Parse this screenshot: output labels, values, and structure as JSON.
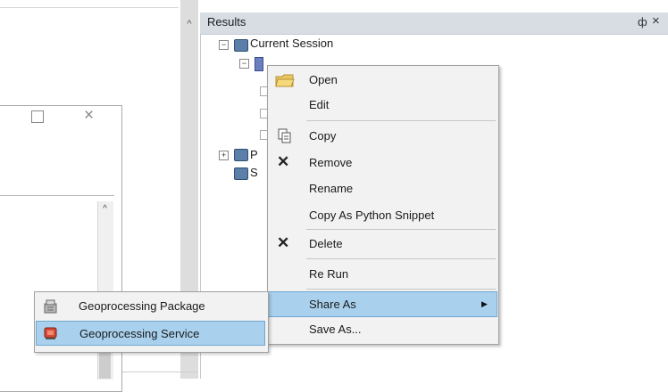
{
  "results_pane": {
    "title": "Results",
    "pin_glyph": "ф",
    "close_glyph": "×",
    "tree": {
      "current_session": "Current Session",
      "child_row_text": "",
      "p_row_text": "P",
      "s_row_text": "S"
    }
  },
  "context_menu": {
    "items": [
      {
        "label": "Open",
        "icon": "open-folder-icon"
      },
      {
        "label": "Edit",
        "icon": ""
      },
      {
        "label": "Copy",
        "icon": "copy-icon"
      },
      {
        "label": "Remove",
        "icon": "remove-x-icon"
      },
      {
        "label": "Rename",
        "icon": ""
      },
      {
        "label": "Copy As Python Snippet",
        "icon": ""
      },
      {
        "label": "Delete",
        "icon": "delete-x-icon"
      },
      {
        "label": "Re Run",
        "icon": ""
      },
      {
        "label": "Share As",
        "icon": "",
        "has_submenu": true
      },
      {
        "label": "Save As...",
        "icon": ""
      }
    ],
    "highlighted": "Share As"
  },
  "submenu": {
    "items": [
      {
        "label": "Geoprocessing Package",
        "icon": "geoprocessing-package-icon"
      },
      {
        "label": "Geoprocessing Service",
        "icon": "geoprocessing-service-icon"
      }
    ],
    "highlighted": "Geoprocessing Service"
  },
  "colors": {
    "highlight": "#a9d1ee",
    "highlight_border": "#6fa7d1",
    "menu_bg": "#f2f2f2"
  }
}
